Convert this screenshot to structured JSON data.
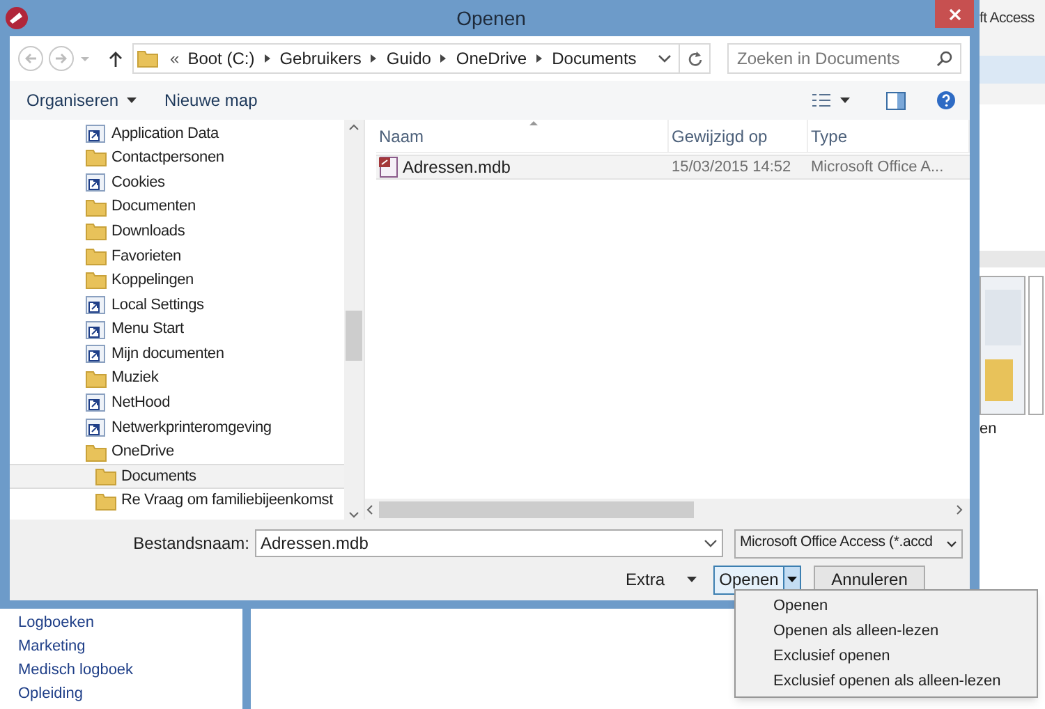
{
  "window": {
    "title": "Openen"
  },
  "background_app": {
    "title": "ft Access",
    "tile_label": "en",
    "sidebar_items": [
      "Logboeken",
      "Marketing",
      "Medisch logboek",
      "Opleiding"
    ]
  },
  "address_bar": {
    "overflow_marker": "«",
    "path": [
      "Boot (C:)",
      "Gebruikers",
      "Guido",
      "OneDrive",
      "Documents"
    ]
  },
  "search": {
    "placeholder": "Zoeken in Documents"
  },
  "toolbar": {
    "buttons": [
      "Organiseren",
      "Nieuwe map"
    ]
  },
  "tree": [
    {
      "label": "Application Data",
      "kind": "shortcut",
      "selected": false
    },
    {
      "label": "Contactpersonen",
      "kind": "folder",
      "selected": false
    },
    {
      "label": "Cookies",
      "kind": "shortcut",
      "selected": false
    },
    {
      "label": "Documenten",
      "kind": "folder",
      "selected": false
    },
    {
      "label": "Downloads",
      "kind": "folder",
      "selected": false
    },
    {
      "label": "Favorieten",
      "kind": "folder",
      "selected": false
    },
    {
      "label": "Koppelingen",
      "kind": "folder",
      "selected": false
    },
    {
      "label": "Local Settings",
      "kind": "shortcut",
      "selected": false
    },
    {
      "label": "Menu Start",
      "kind": "shortcut",
      "selected": false
    },
    {
      "label": "Mijn documenten",
      "kind": "shortcut",
      "selected": false
    },
    {
      "label": "Muziek",
      "kind": "folder",
      "selected": false
    },
    {
      "label": "NetHood",
      "kind": "shortcut",
      "selected": false
    },
    {
      "label": "Netwerkprinteromgeving",
      "kind": "shortcut",
      "selected": false
    },
    {
      "label": "OneDrive",
      "kind": "folder",
      "selected": false,
      "children": [
        {
          "label": "Documents",
          "kind": "folder",
          "selected": true
        },
        {
          "label": "Re Vraag om familiebijeenkomst",
          "kind": "folder",
          "selected": false
        }
      ]
    }
  ],
  "file_list": {
    "columns": [
      "Naam",
      "Gewijzigd op",
      "Type"
    ],
    "rows": [
      {
        "name": "Adressen.mdb",
        "modified": "15/03/2015 14:52",
        "type": "Microsoft Office A..."
      }
    ]
  },
  "file_name": {
    "label": "Bestandsnaam:",
    "value": "Adressen.mdb"
  },
  "file_type": {
    "value": "Microsoft Office Access (*.accd"
  },
  "buttons": {
    "extra": "Extra",
    "open": "Openen",
    "cancel": "Annuleren"
  },
  "open_menu": {
    "items": [
      "Openen",
      "Openen als alleen-lezen",
      "Exclusief openen",
      "Exclusief openen als alleen-lezen"
    ]
  }
}
